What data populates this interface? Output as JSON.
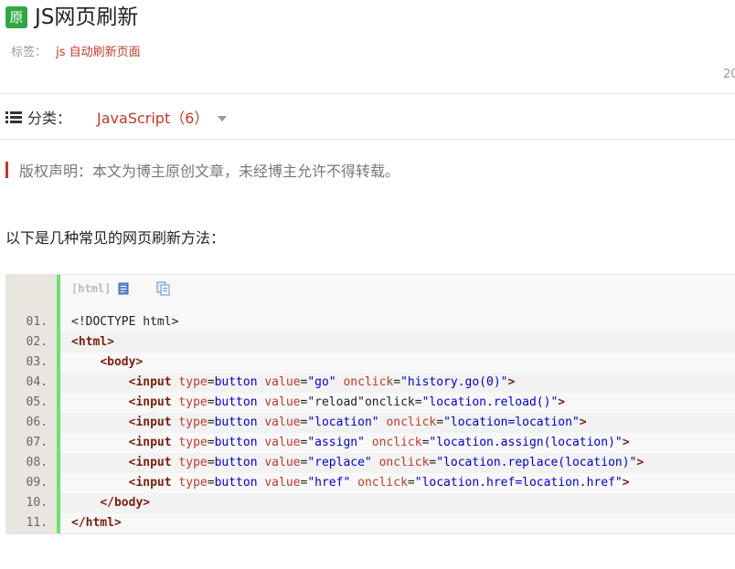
{
  "header": {
    "badge": "原",
    "title": "JS网页刷新",
    "tags_label": "标签：",
    "tag": "js 自动刷新页面",
    "date_fragment": "20"
  },
  "category": {
    "label": "分类：",
    "value": "JavaScript（6）"
  },
  "copyright_notice": "版权声明：本文为博主原创文章，未经博主允许不得转载。",
  "intro": "以下是几种常见的网页刷新方法：",
  "code_block": {
    "language": "[html]",
    "lines": [
      {
        "num": "01.",
        "tokens": [
          {
            "t": "pl",
            "v": "<!DOCTYPE html>"
          }
        ]
      },
      {
        "num": "02.",
        "tokens": [
          {
            "t": "tg",
            "v": "<html>"
          }
        ]
      },
      {
        "num": "03.",
        "tokens": [
          {
            "t": "pl",
            "v": "    "
          },
          {
            "t": "tg",
            "v": "<body>"
          }
        ]
      },
      {
        "num": "04.",
        "tokens": [
          {
            "t": "pl",
            "v": "        "
          },
          {
            "t": "tg",
            "v": "<input"
          },
          {
            "t": "pl",
            "v": " "
          },
          {
            "t": "at",
            "v": "type"
          },
          {
            "t": "pl",
            "v": "="
          },
          {
            "t": "vl",
            "v": "button"
          },
          {
            "t": "pl",
            "v": " "
          },
          {
            "t": "at",
            "v": "value"
          },
          {
            "t": "pl",
            "v": "="
          },
          {
            "t": "vl",
            "v": "\"go\""
          },
          {
            "t": "pl",
            "v": " "
          },
          {
            "t": "at",
            "v": "onclick"
          },
          {
            "t": "pl",
            "v": "="
          },
          {
            "t": "vl",
            "v": "\"history.go(0)\""
          },
          {
            "t": "tg",
            "v": ">"
          }
        ]
      },
      {
        "num": "05.",
        "tokens": [
          {
            "t": "pl",
            "v": "        "
          },
          {
            "t": "tg",
            "v": "<input"
          },
          {
            "t": "pl",
            "v": " "
          },
          {
            "t": "at",
            "v": "type"
          },
          {
            "t": "pl",
            "v": "="
          },
          {
            "t": "vl",
            "v": "button"
          },
          {
            "t": "pl",
            "v": " "
          },
          {
            "t": "at",
            "v": "value"
          },
          {
            "t": "pl",
            "v": "=\"reload\"onclick="
          },
          {
            "t": "vl",
            "v": "\"location.reload()\""
          },
          {
            "t": "tg",
            "v": ">"
          }
        ]
      },
      {
        "num": "06.",
        "tokens": [
          {
            "t": "pl",
            "v": "        "
          },
          {
            "t": "tg",
            "v": "<input"
          },
          {
            "t": "pl",
            "v": " "
          },
          {
            "t": "at",
            "v": "type"
          },
          {
            "t": "pl",
            "v": "="
          },
          {
            "t": "vl",
            "v": "button"
          },
          {
            "t": "pl",
            "v": " "
          },
          {
            "t": "at",
            "v": "value"
          },
          {
            "t": "pl",
            "v": "="
          },
          {
            "t": "vl",
            "v": "\"location\""
          },
          {
            "t": "pl",
            "v": " "
          },
          {
            "t": "at",
            "v": "onclick"
          },
          {
            "t": "pl",
            "v": "="
          },
          {
            "t": "vl",
            "v": "\"location=location\""
          },
          {
            "t": "tg",
            "v": ">"
          }
        ]
      },
      {
        "num": "07.",
        "tokens": [
          {
            "t": "pl",
            "v": "        "
          },
          {
            "t": "tg",
            "v": "<input"
          },
          {
            "t": "pl",
            "v": " "
          },
          {
            "t": "at",
            "v": "type"
          },
          {
            "t": "pl",
            "v": "="
          },
          {
            "t": "vl",
            "v": "button"
          },
          {
            "t": "pl",
            "v": " "
          },
          {
            "t": "at",
            "v": "value"
          },
          {
            "t": "pl",
            "v": "="
          },
          {
            "t": "vl",
            "v": "\"assign\""
          },
          {
            "t": "pl",
            "v": " "
          },
          {
            "t": "at",
            "v": "onclick"
          },
          {
            "t": "pl",
            "v": "="
          },
          {
            "t": "vl",
            "v": "\"location.assign(location)\""
          },
          {
            "t": "tg",
            "v": ">"
          }
        ]
      },
      {
        "num": "08.",
        "tokens": [
          {
            "t": "pl",
            "v": "        "
          },
          {
            "t": "tg",
            "v": "<input"
          },
          {
            "t": "pl",
            "v": " "
          },
          {
            "t": "at",
            "v": "type"
          },
          {
            "t": "pl",
            "v": "="
          },
          {
            "t": "vl",
            "v": "button"
          },
          {
            "t": "pl",
            "v": " "
          },
          {
            "t": "at",
            "v": "value"
          },
          {
            "t": "pl",
            "v": "="
          },
          {
            "t": "vl",
            "v": "\"replace\""
          },
          {
            "t": "pl",
            "v": " "
          },
          {
            "t": "at",
            "v": "onclick"
          },
          {
            "t": "pl",
            "v": "="
          },
          {
            "t": "vl",
            "v": "\"location.replace(location)\""
          },
          {
            "t": "tg",
            "v": ">"
          }
        ]
      },
      {
        "num": "09.",
        "tokens": [
          {
            "t": "pl",
            "v": "        "
          },
          {
            "t": "tg",
            "v": "<input"
          },
          {
            "t": "pl",
            "v": " "
          },
          {
            "t": "at",
            "v": "type"
          },
          {
            "t": "pl",
            "v": "="
          },
          {
            "t": "vl",
            "v": "button"
          },
          {
            "t": "pl",
            "v": " "
          },
          {
            "t": "at",
            "v": "value"
          },
          {
            "t": "pl",
            "v": "="
          },
          {
            "t": "vl",
            "v": "\"href\""
          },
          {
            "t": "pl",
            "v": " "
          },
          {
            "t": "at",
            "v": "onclick"
          },
          {
            "t": "pl",
            "v": "="
          },
          {
            "t": "vl",
            "v": "\"location.href=location.href\""
          },
          {
            "t": "tg",
            "v": ">"
          }
        ]
      },
      {
        "num": "10.",
        "tokens": [
          {
            "t": "pl",
            "v": "    "
          },
          {
            "t": "tg",
            "v": "</body>"
          }
        ]
      },
      {
        "num": "11.",
        "tokens": [
          {
            "t": "tg",
            "v": "</html>"
          }
        ]
      }
    ]
  },
  "icons": {
    "view_source": "document-icon",
    "copy": "copy-icon",
    "category": "list-icon",
    "dropdown": "caret-down-icon"
  },
  "colors": {
    "accent": "#c0392b",
    "badge": "#2fa843",
    "gutter_bar": "#6ce26c"
  }
}
